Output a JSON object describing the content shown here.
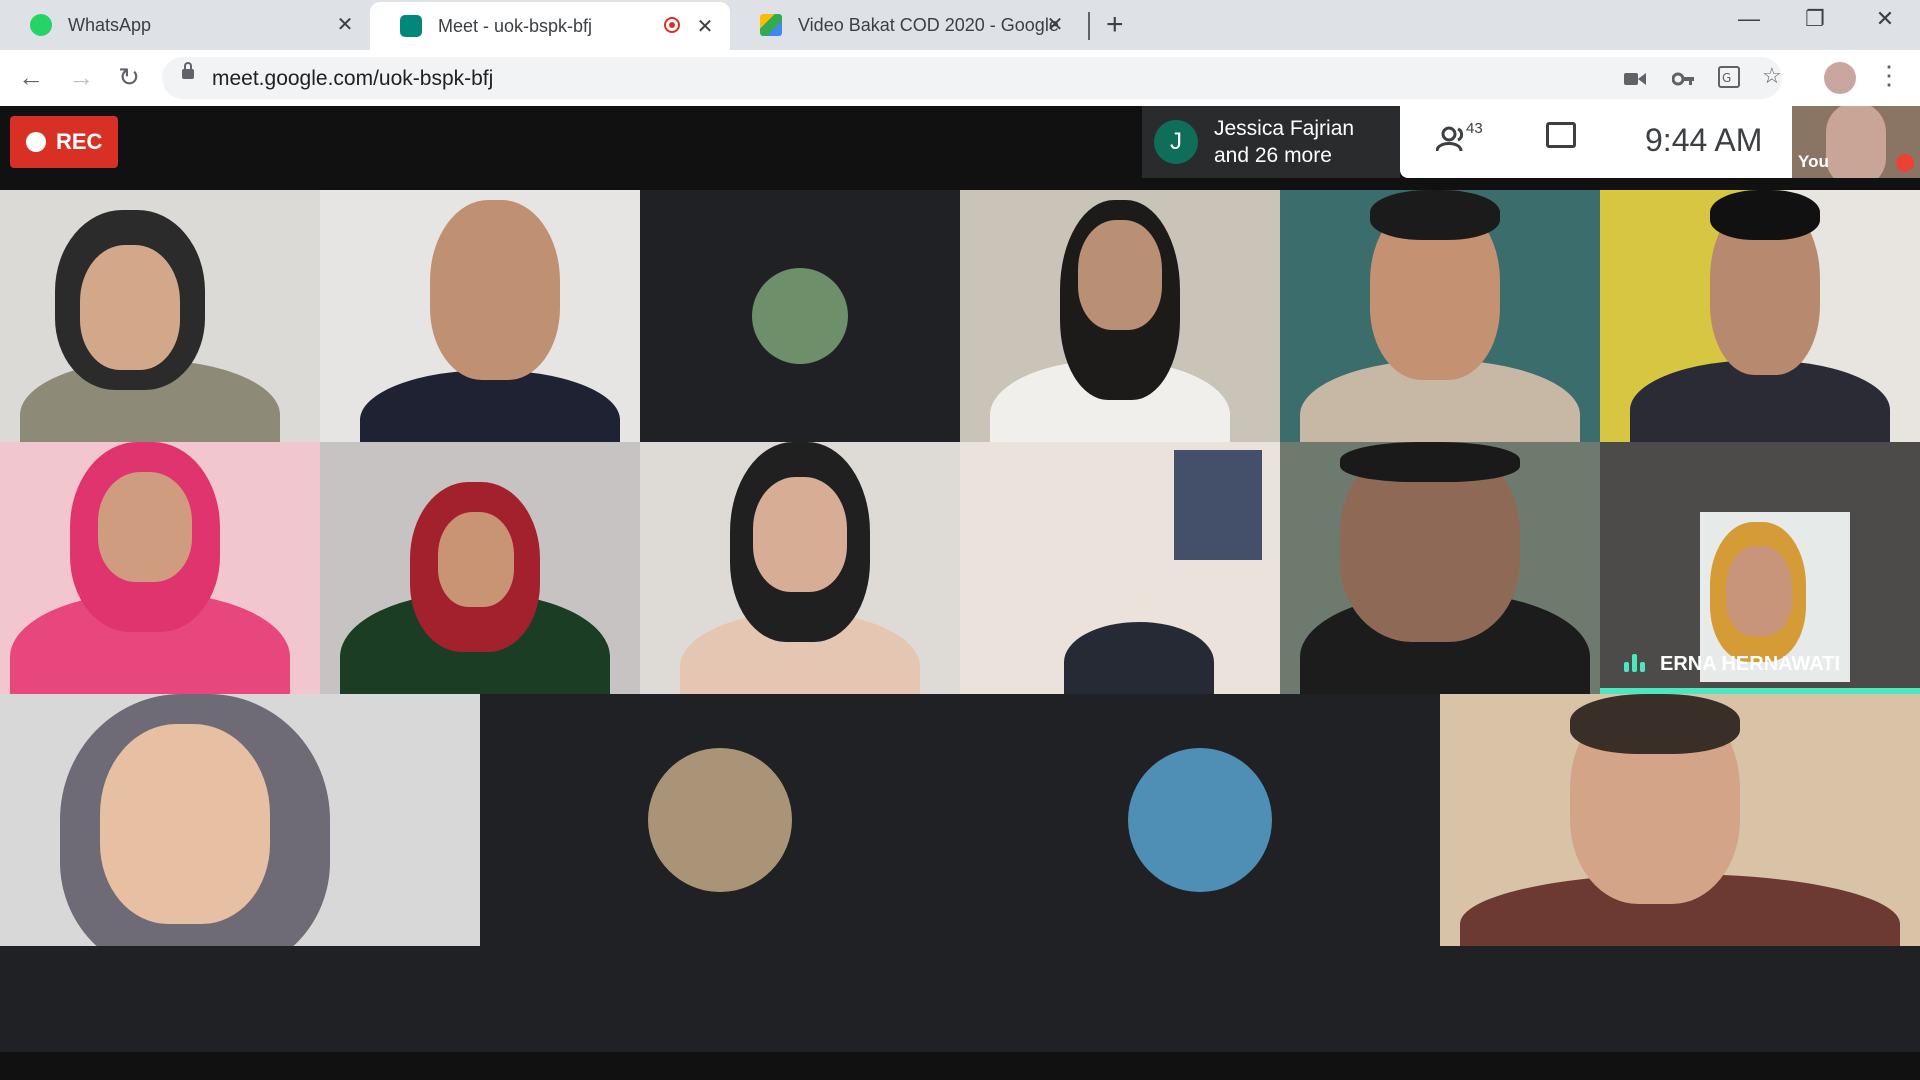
{
  "browser": {
    "tabs": [
      {
        "title": "WhatsApp",
        "close": "✕"
      },
      {
        "title": "Meet - uok-bspk-bfj",
        "close": "✕"
      },
      {
        "title": "Video Bakat COD 2020 - Google",
        "close": "✕"
      }
    ],
    "new_tab": "+",
    "window_controls": {
      "minimize": "—",
      "restore": "❐",
      "close": "✕"
    },
    "nav": {
      "back": "←",
      "forward": "→",
      "reload": "↻"
    },
    "url": "meet.google.com/uok-bspk-bfj",
    "omnibox_icons": [
      "camera-icon",
      "key-icon",
      "translate-icon",
      "star-icon"
    ],
    "menu": "⋮"
  },
  "meet": {
    "rec_label": "REC",
    "joined": {
      "initial": "J",
      "name": "Jessica Fajrian",
      "more": "and 26 more"
    },
    "people_count": "43",
    "time": "9:44 AM",
    "self_label": "You",
    "active_speaker": "ERNA HERNAWATI"
  },
  "colors": {
    "rec": "#d93025",
    "speaker_accent": "#4de6c1",
    "meet_bg": "#202124"
  }
}
